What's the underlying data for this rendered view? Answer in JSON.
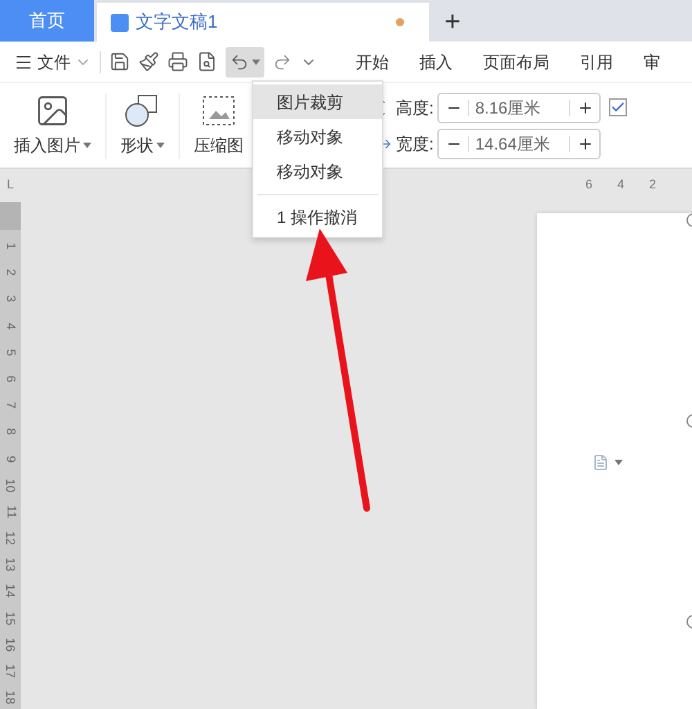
{
  "tabs": [
    {
      "label": "首页",
      "selected": false,
      "kind": "home"
    },
    {
      "label": "文字文稿1",
      "selected": true,
      "kind": "document",
      "modified": true
    }
  ],
  "new_tab": "+",
  "file_menu": "文件",
  "ribbon_tabs": [
    "开始",
    "插入",
    "页面布局",
    "引用",
    "审"
  ],
  "ribbon_tools": [
    {
      "label": "插入图片",
      "has_menu": true,
      "kind": "picture"
    },
    {
      "label": "形状",
      "has_menu": true,
      "kind": "shape"
    },
    {
      "label": "压缩图",
      "has_menu": false,
      "kind": "compress"
    }
  ],
  "size_fields": [
    {
      "label": "高度:",
      "value": "8.16厘米",
      "kind": "height"
    },
    {
      "label": "宽度:",
      "value": "14.64厘米",
      "kind": "width"
    }
  ],
  "lock_ratio": {
    "checked": true
  },
  "undo_menu": {
    "items": [
      {
        "label": "图片裁剪",
        "selected": true
      },
      {
        "label": "移动对象",
        "selected": false
      },
      {
        "label": "移动对象",
        "selected": false
      }
    ],
    "summary": "1 操作撤消"
  },
  "ruler": {
    "corner": "L",
    "horizontal": [
      "6",
      "4",
      "2"
    ],
    "vertical": [
      "1",
      "2",
      "3",
      "4",
      "5",
      "6",
      "7",
      "8",
      "9",
      "10",
      "11",
      "12",
      "13",
      "14",
      "15",
      "16",
      "17",
      "18"
    ]
  }
}
